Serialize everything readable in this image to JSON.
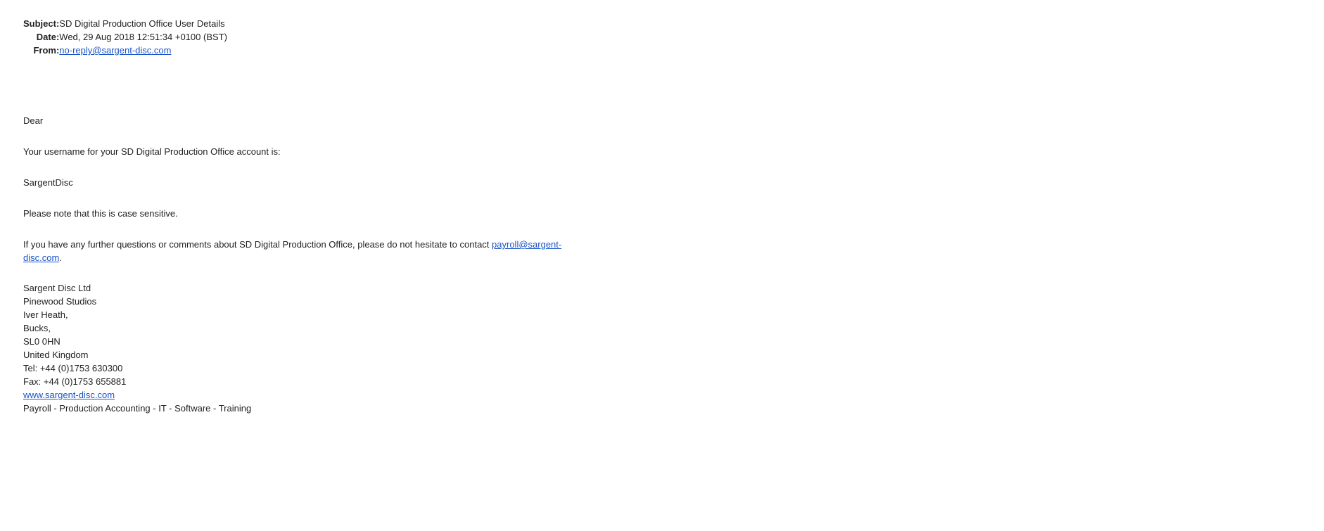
{
  "headers": {
    "subject_label": "Subject:",
    "subject": "SD Digital Production Office User Details",
    "date_label": "Date:",
    "date": "Wed, 29 Aug 2018 12:51:34 +0100 (BST)",
    "from_label": "From:",
    "from": "no-reply@sargent-disc.com"
  },
  "body": {
    "greeting": "Dear",
    "username_intro": "Your username for your SD Digital Production Office account is:",
    "username": "SargentDisc",
    "case_note": "Please note that this is case sensitive.",
    "contact_text": "If you have any further questions or comments about SD Digital Production Office, please do not hesitate to contact ",
    "contact_email": "payroll@sargent-disc.com",
    "contact_end": "."
  },
  "signature": {
    "company": "Sargent Disc Ltd",
    "address1": "Pinewood Studios",
    "address2": "Iver Heath,",
    "address3": "Bucks,",
    "postcode": "SL0 0HN",
    "country": "United Kingdom",
    "tel": "Tel: +44 (0)1753 630300",
    "fax": "Fax: +44 (0)1753 655881",
    "website": "www.sargent-disc.com",
    "services": "Payroll - Production Accounting - IT - Software - Training"
  }
}
